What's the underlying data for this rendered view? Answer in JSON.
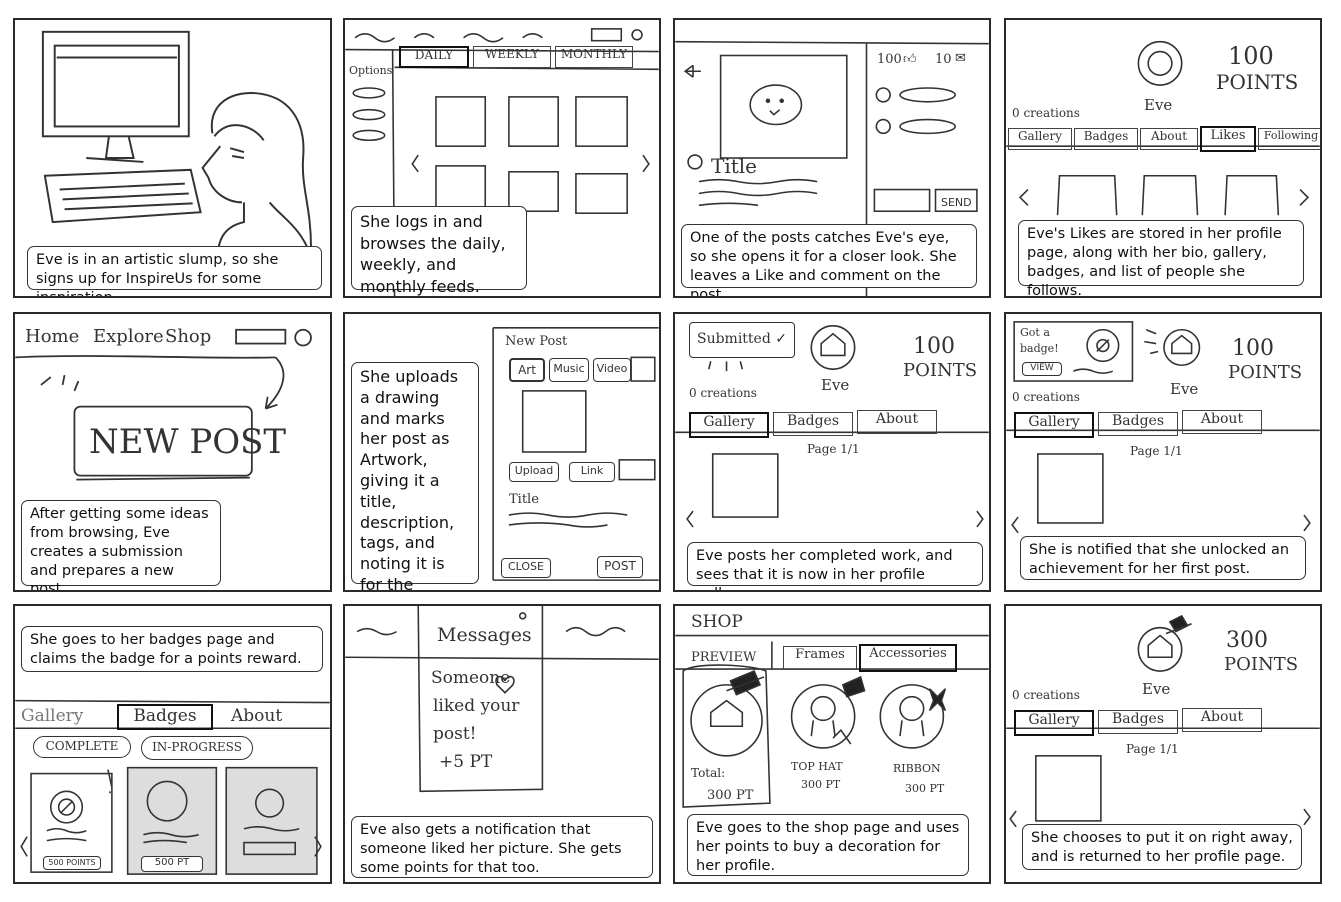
{
  "panels": {
    "p1": {
      "caption": "Eve is in an artistic slump, so she signs up for InspireUs for some inspiration."
    },
    "p2": {
      "caption": "She logs in and browses the daily, weekly, and monthly feeds.",
      "tabs": [
        "DAILY",
        "WEEKLY",
        "MONTHLY"
      ],
      "options_label": "Options"
    },
    "p3": {
      "caption": "One of the posts catches Eve's eye, so she opens it for a closer look. She leaves a Like and comment on the post.",
      "title_label": "Title",
      "likes": "100",
      "comments": "10",
      "send_label": "SEND"
    },
    "p4": {
      "caption": "Eve's Likes are stored in her profile page, along with her bio, gallery, badges, and list of people she follows.",
      "points": "100",
      "points_label": "POINTS",
      "name": "Eve",
      "creations": "0 creations",
      "tabs": [
        "Gallery",
        "Badges",
        "About",
        "Likes",
        "Following"
      ]
    },
    "p5": {
      "caption": "After getting some ideas from browsing, Eve creates a submission and prepares a new post.",
      "nav": [
        "Home",
        "Explore",
        "Shop"
      ],
      "new_post": "NEW POST"
    },
    "p6": {
      "caption": "She uploads a drawing and marks her post as Artwork, giving it a title, description, tags, and noting it is for the current daily prompt.",
      "form_title": "New Post",
      "types": [
        "Art",
        "Music",
        "Video"
      ],
      "upload": "Upload",
      "link": "Link",
      "title_label": "Title",
      "close": "CLOSE",
      "post": "POST"
    },
    "p7": {
      "caption": "Eve posts her completed work, and sees that it is now in her profile gallery.",
      "submitted": "Submitted ✓",
      "points": "100",
      "points_label": "POINTS",
      "name": "Eve",
      "creations": "0 creations",
      "tabs": [
        "Gallery",
        "Badges",
        "About"
      ],
      "page": "Page 1/1"
    },
    "p8": {
      "caption": "She is notified that she unlocked an achievement for her first post.",
      "note1": "Got a",
      "note2": "badge!",
      "view": "VIEW",
      "points": "100",
      "points_label": "POINTS",
      "name": "Eve",
      "creations": "0 creations",
      "tabs": [
        "Gallery",
        "Badges",
        "About"
      ],
      "page": "Page 1/1"
    },
    "p9": {
      "caption": "She goes to her badges page and claims the badge for a points reward.",
      "tabs": [
        "Gallery",
        "Badges",
        "About"
      ],
      "filters": [
        "COMPLETE",
        "IN-PROGRESS"
      ],
      "claim": "500 POINTS",
      "reward2": "500 PT"
    },
    "p10": {
      "caption": "Eve also gets a notification that someone liked her picture. She gets some points for that too.",
      "title": "Messages",
      "line1": "Someone",
      "line2": "liked your",
      "line3": "post!",
      "line4": "+5 PT"
    },
    "p11": {
      "caption": "Eve goes to the shop page and uses her points to buy a decoration for her profile.",
      "title": "SHOP",
      "preview": "PREVIEW",
      "tabs": [
        "Frames",
        "Accessories"
      ],
      "total_label": "Total:",
      "total": "300 PT",
      "items": [
        {
          "name": "TOP HAT",
          "price": "300 PT"
        },
        {
          "name": "RIBBON",
          "price": "300 PT"
        }
      ]
    },
    "p12": {
      "caption": "She chooses to put it on right away, and is returned to her profile page.",
      "points": "300",
      "points_label": "POINTS",
      "name": "Eve",
      "creations": "0 creations",
      "tabs": [
        "Gallery",
        "Badges",
        "About"
      ],
      "page": "Page 1/1"
    }
  }
}
